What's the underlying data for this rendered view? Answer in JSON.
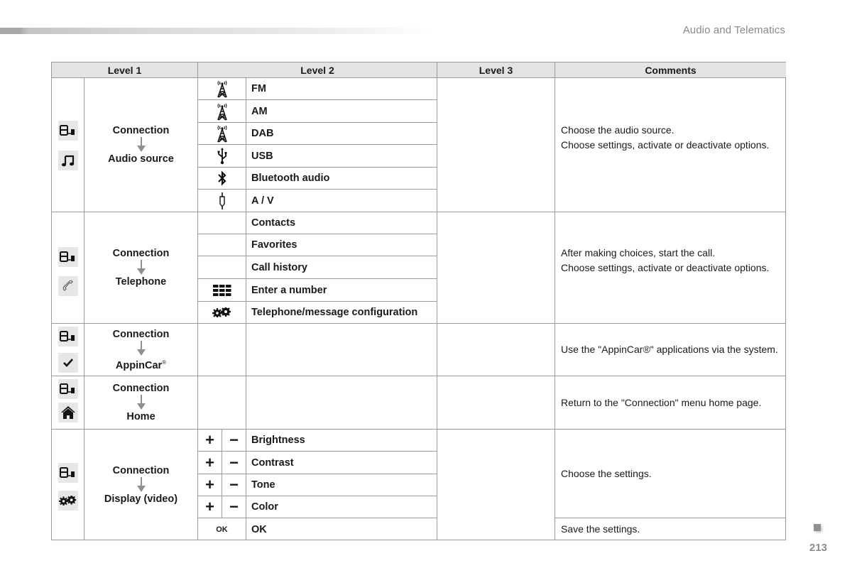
{
  "page": {
    "section_title": "Audio and Telematics",
    "page_number": "213"
  },
  "table": {
    "headers": [
      "Level 1",
      "Level 2",
      "Level 3",
      "Comments"
    ],
    "sections": [
      {
        "id": "audio-source",
        "level1_icons": [
          "connection-icon",
          "music-note-icon"
        ],
        "level1_from": "Connection",
        "level1_to": "Audio source",
        "level2": [
          {
            "icon": "antenna-icon",
            "label": "FM"
          },
          {
            "icon": "antenna-icon",
            "label": "AM"
          },
          {
            "icon": "antenna-icon",
            "label": "DAB"
          },
          {
            "icon": "usb-icon",
            "label": "USB"
          },
          {
            "icon": "bluetooth-icon",
            "label": "Bluetooth audio"
          },
          {
            "icon": "jack-plug-icon",
            "label": "A / V"
          }
        ],
        "comments": [
          "Choose the audio source.",
          "Choose settings, activate or deactivate options."
        ]
      },
      {
        "id": "telephone",
        "level1_icons": [
          "connection-icon",
          "phone-handset-icon"
        ],
        "level1_from": "Connection",
        "level1_to": "Telephone",
        "level2": [
          {
            "icon": "",
            "label": "Contacts"
          },
          {
            "icon": "",
            "label": "Favorites"
          },
          {
            "icon": "",
            "label": "Call history"
          },
          {
            "icon": "keypad-icon",
            "label": "Enter a number"
          },
          {
            "icon": "gears-icon",
            "label": "Telephone/message configuration"
          }
        ],
        "comments": [
          "After making choices, start the call.",
          "Choose settings, activate or deactivate options."
        ]
      },
      {
        "id": "appincar",
        "level1_icons": [
          "connection-icon",
          "checkmark-icon"
        ],
        "level1_from": "Connection",
        "level1_to": "AppinCar",
        "level1_to_sup": "®",
        "comments": [
          "Use the \"AppinCar®\" applications via the system."
        ]
      },
      {
        "id": "home",
        "level1_icons": [
          "connection-icon",
          "home-icon"
        ],
        "level1_from": "Connection",
        "level1_to": "Home",
        "comments": [
          "Return to the \"Connection\" menu home page."
        ]
      },
      {
        "id": "display-video",
        "level1_icons": [
          "connection-icon",
          "gears-icon"
        ],
        "level1_from": "Connection",
        "level1_to": "Display (video)",
        "level2": [
          {
            "plus": "+",
            "minus": "−",
            "label": "Brightness"
          },
          {
            "plus": "+",
            "minus": "−",
            "label": "Contrast"
          },
          {
            "plus": "+",
            "minus": "−",
            "label": "Tone"
          },
          {
            "plus": "+",
            "minus": "−",
            "label": "Color"
          },
          {
            "ok_icon": "OK",
            "label": "OK"
          }
        ],
        "comments": [
          "Choose the settings."
        ],
        "ok_comment": "Save the settings."
      }
    ]
  }
}
